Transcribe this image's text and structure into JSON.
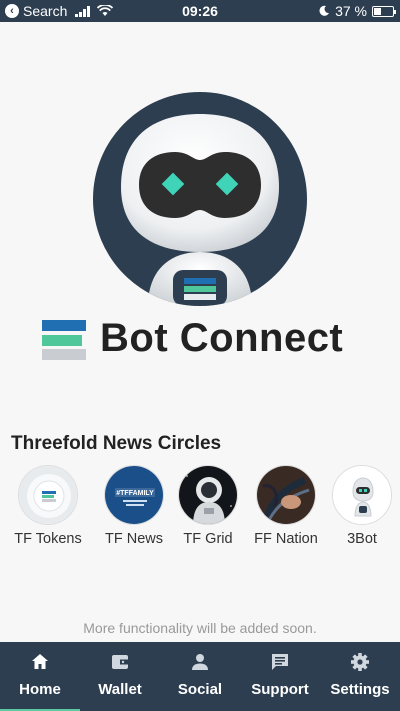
{
  "status_bar": {
    "back_label": "Search",
    "time": "09:26",
    "battery": "37 %",
    "battery_level": 0.37
  },
  "brand": {
    "title": "Bot Connect",
    "colors": {
      "blue": "#1f6fb2",
      "green": "#4fc79a",
      "grey": "#c9cdd2",
      "navy": "#2c3e50",
      "teal": "#3fd3b8"
    }
  },
  "news": {
    "title": "Threefold News Circles",
    "items": [
      {
        "label": "TF Tokens",
        "icon": "tf-tokens-avatar"
      },
      {
        "label": "TF News",
        "icon": "tffamily-avatar",
        "badge": "#TFFAMILY"
      },
      {
        "label": "TF Grid",
        "icon": "astronaut-avatar"
      },
      {
        "label": "FF Nation",
        "icon": "ff-nation-avatar"
      },
      {
        "label": "3Bot",
        "icon": "3bot-avatar"
      }
    ]
  },
  "notice": "More functionality will be added soon.",
  "nav": {
    "items": [
      {
        "label": "Home",
        "icon": "home-icon",
        "active": true
      },
      {
        "label": "Wallet",
        "icon": "wallet-icon"
      },
      {
        "label": "Social",
        "icon": "person-icon"
      },
      {
        "label": "Support",
        "icon": "chat-icon"
      },
      {
        "label": "Settings",
        "icon": "gear-icon"
      }
    ]
  }
}
